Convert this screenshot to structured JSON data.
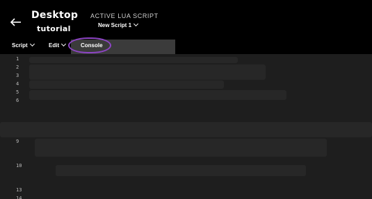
{
  "header": {
    "title_line1": "Desktop",
    "title_line2": "tutorial",
    "active_label": "ACTIVE LUA SCRIPT",
    "script_name": "New Script 1",
    "back_icon": "arrow-left-icon"
  },
  "menu": {
    "script_label": "Script",
    "edit_label": "Edit",
    "console_label": "Console"
  },
  "editor": {
    "line_numbers": [
      "1",
      "2",
      "3",
      "4",
      "5",
      "6",
      "9",
      "10",
      "13",
      "14"
    ]
  },
  "colors": {
    "background": "#000000",
    "editor_background": "#1e1e1e",
    "console_tab_background": "#3b3b3b",
    "highlight_ring": "#8e45c6"
  }
}
